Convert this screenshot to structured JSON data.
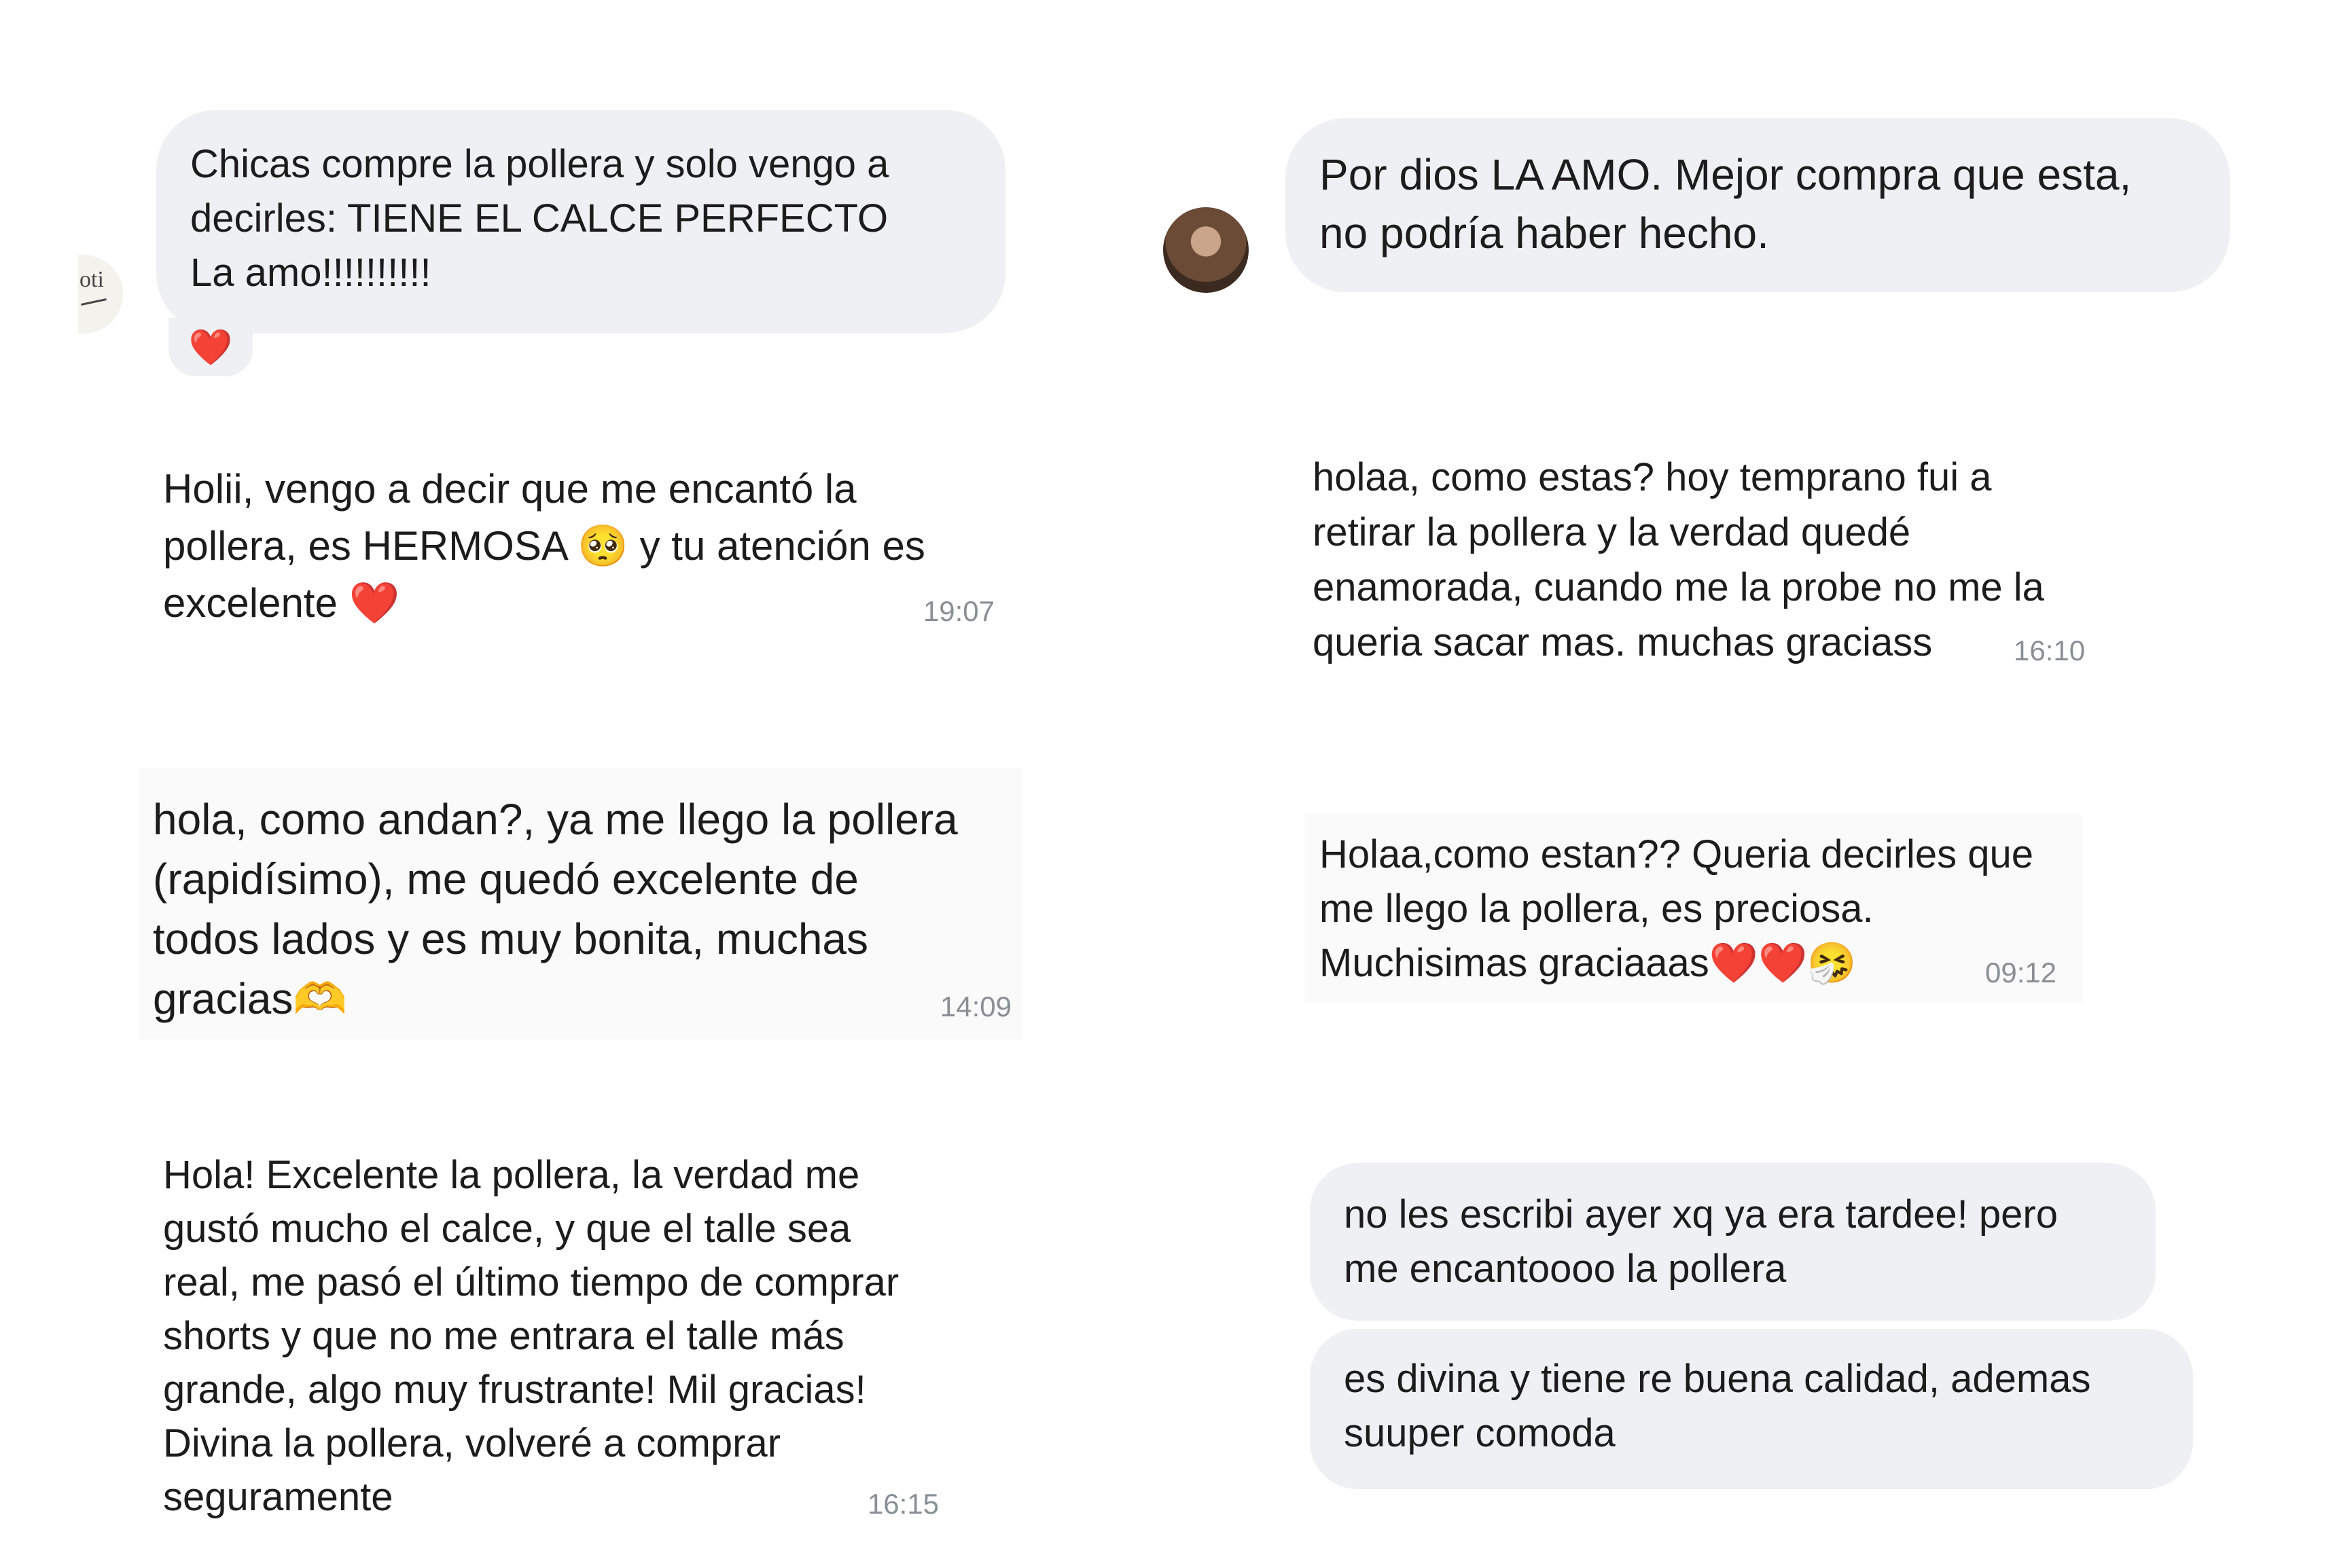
{
  "colors": {
    "bubble_gray": "#eef0f3",
    "text": "#1c1c1c",
    "timestamp": "#8a8f94",
    "heart": "#e0242f"
  },
  "messages": {
    "m1": {
      "text": "Chicas compre la pollera y solo vengo a\ndecirles: TIENE EL CALCE PERFECTO\nLa amo!!!!!!!!!!",
      "avatar_text": "oti",
      "reaction": "❤️"
    },
    "m2": {
      "text": "Holii, vengo a decir que me encantó la\npollera, es HERMOSA 🥺 y tu atención es\nexcelente ❤️",
      "time": "19:07"
    },
    "m3": {
      "text": "hola, como andan?, ya me llego la pollera\n(rapidísimo), me quedó excelente de\ntodos lados y es muy bonita, muchas\ngracias🫶",
      "time": "14:09"
    },
    "m4": {
      "text": "Hola! Excelente la pollera, la verdad me\ngustó mucho el calce, y que el talle sea\nreal, me pasó el último tiempo de comprar\nshorts y que no me entrara el talle más\ngrande, algo muy frustrante! Mil gracias!\nDivina la pollera, volveré a comprar\nseguramente",
      "time": "16:15"
    },
    "m5": {
      "text": "Por dios LA AMO. Mejor compra que esta,\nno podría haber hecho."
    },
    "m6": {
      "text": "holaa, como estas? hoy temprano fui a\nretirar la pollera y la verdad quedé\nenamorada, cuando me la probe no me la\nqueria sacar mas. muchas graciass",
      "time": "16:10"
    },
    "m7": {
      "text": "Holaa,como estan?? Queria decirles que\nme llego la pollera, es preciosa.\nMuchisimas graciaaas❤️❤️🤧",
      "time": "09:12"
    },
    "m8": {
      "text": "no les escribi ayer xq ya era tardee! pero\nme encantoooo la pollera"
    },
    "m9": {
      "text": "es divina y tiene re buena calidad, ademas\nsuuper comoda"
    }
  }
}
